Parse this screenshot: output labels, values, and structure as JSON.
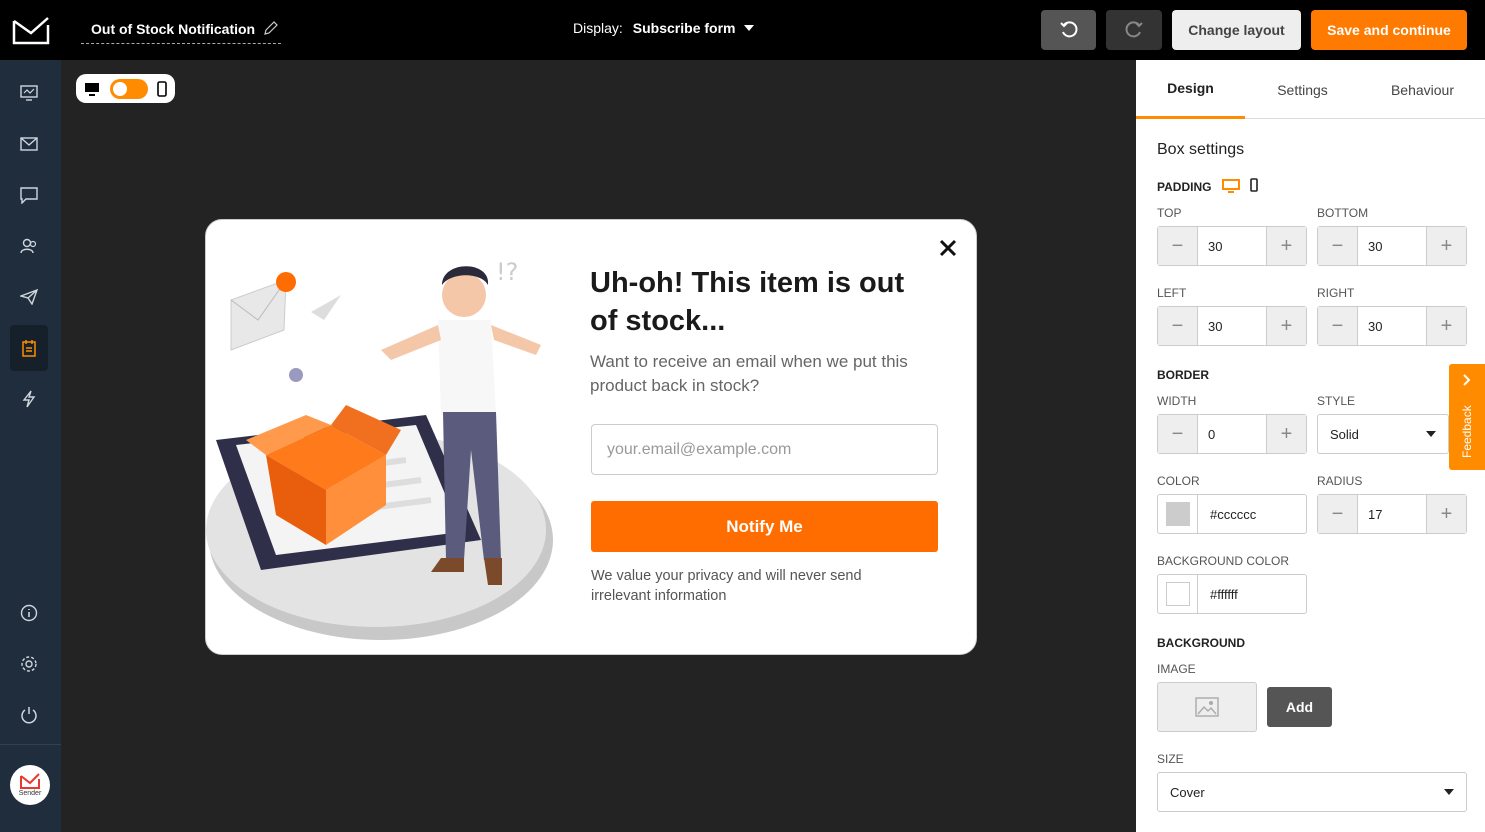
{
  "topbar": {
    "doc_title": "Out of Stock Notification",
    "display_label": "Display:",
    "display_value": "Subscribe form",
    "change_layout": "Change layout",
    "save_continue": "Save and continue"
  },
  "sidebar": {
    "items": [
      "overview-icon",
      "mail-icon",
      "chat-icon",
      "subscribers-icon",
      "campaigns-icon",
      "forms-icon",
      "automation-icon"
    ],
    "bottom": [
      "info-icon",
      "settings-icon",
      "power-icon"
    ],
    "brand": "Sender"
  },
  "popup": {
    "headline": "Uh-oh! This item is out of stock...",
    "subtext": "Want to receive an email when we put this product back in stock?",
    "email_placeholder": "your.email@example.com",
    "button": "Notify Me",
    "privacy": "We value your privacy and will never send irrelevant information"
  },
  "panel": {
    "tabs": [
      "Design",
      "Settings",
      "Behaviour"
    ],
    "box_settings": "Box settings",
    "padding": {
      "title": "PADDING",
      "top_label": "TOP",
      "top": "30",
      "bottom_label": "BOTTOM",
      "bottom": "30",
      "left_label": "LEFT",
      "left": "30",
      "right_label": "RIGHT",
      "right": "30"
    },
    "border": {
      "title": "BORDER",
      "width_label": "WIDTH",
      "width": "0",
      "style_label": "STYLE",
      "style": "Solid",
      "color_label": "COLOR",
      "color": "#cccccc",
      "radius_label": "RADIUS",
      "radius": "17"
    },
    "bg_color": {
      "label": "BACKGROUND COLOR",
      "value": "#ffffff"
    },
    "background": {
      "title": "BACKGROUND",
      "image_label": "IMAGE",
      "add": "Add",
      "size_label": "SIZE",
      "size": "Cover"
    },
    "feedback": "Feedback"
  },
  "colors": {
    "accent": "#ff8c00",
    "button": "#ff6d00",
    "sidebar": "#1f2d3d"
  }
}
